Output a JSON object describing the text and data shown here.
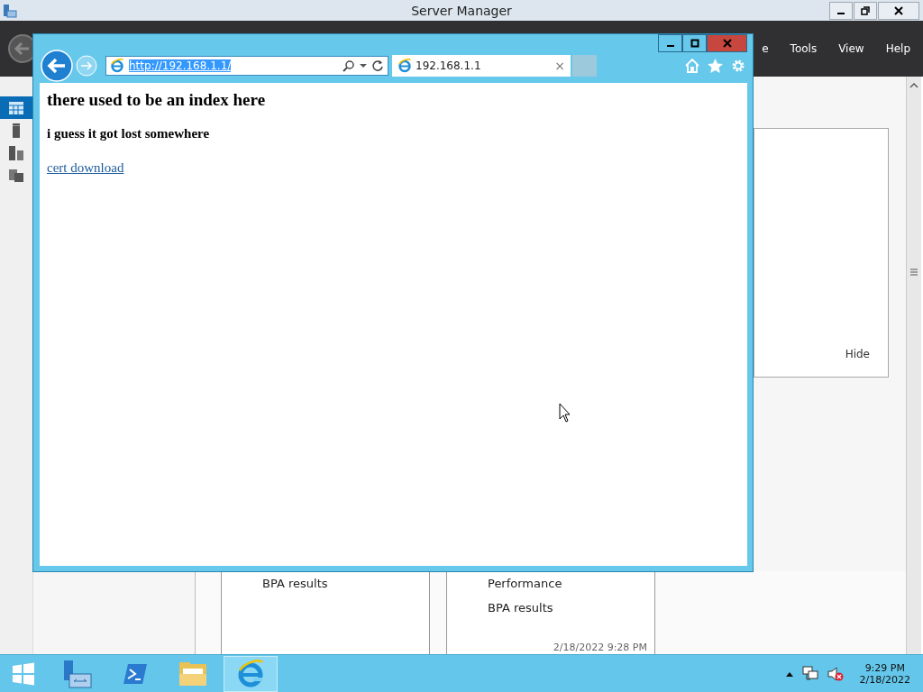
{
  "server_manager": {
    "title": "Server Manager",
    "menu": [
      "e",
      "Tools",
      "View",
      "Help"
    ],
    "sidebar": [
      {
        "kind": "dashboard",
        "selected": true
      },
      {
        "kind": "server",
        "selected": false
      },
      {
        "kind": "servers",
        "selected": false
      },
      {
        "kind": "files",
        "selected": false
      }
    ],
    "hide_link": "Hide",
    "tiles": [
      {
        "items": [
          "BPA results"
        ]
      },
      {
        "items": [
          "Performance",
          "BPA results"
        ],
        "timestamp": "2/18/2022 9:28 PM"
      }
    ]
  },
  "browser": {
    "address": "http://192.168.1.1/",
    "tab": {
      "title": "192.168.1.1",
      "close": "×"
    },
    "page": {
      "heading": "there used to be an index here",
      "subheading": "i guess it got lost somewhere",
      "link": "cert download"
    }
  },
  "taskbar": {
    "apps": [
      {
        "kind": "start",
        "selected": false
      },
      {
        "kind": "server-manager",
        "selected": false
      },
      {
        "kind": "powershell",
        "selected": false
      },
      {
        "kind": "explorer",
        "selected": false
      },
      {
        "kind": "ie",
        "selected": true
      }
    ],
    "clock": {
      "time": "9:29 PM",
      "date": "2/18/2022"
    }
  }
}
